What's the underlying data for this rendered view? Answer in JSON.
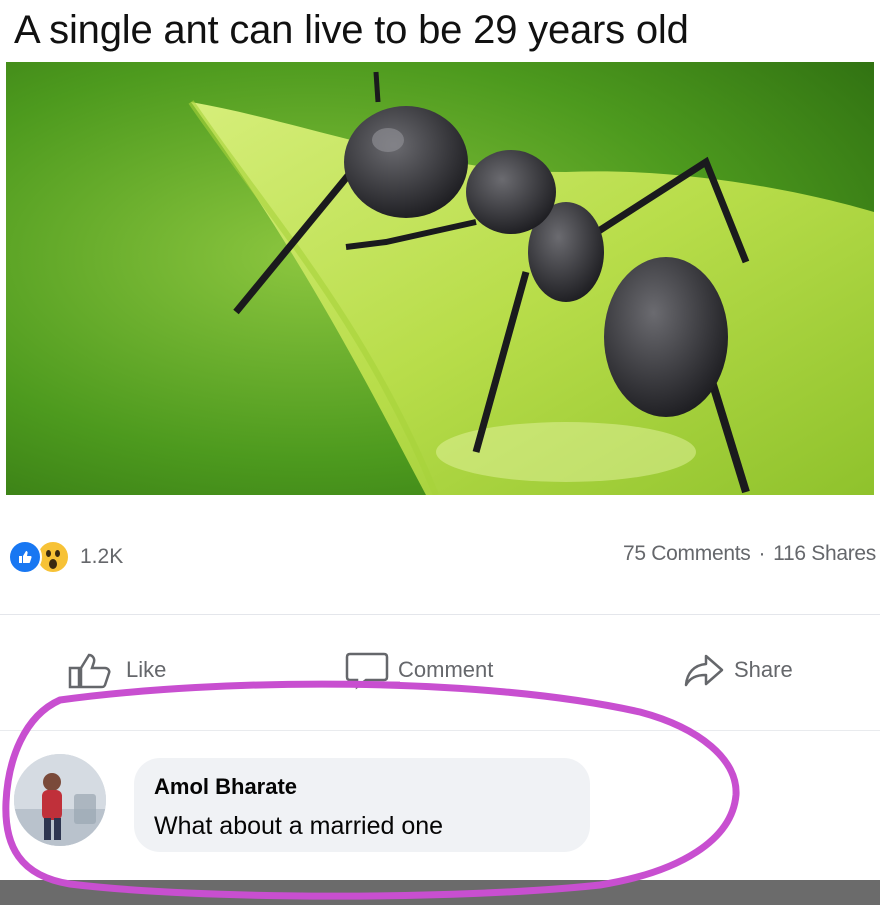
{
  "headline": "A single ant can live to be 29 years old",
  "photo": {
    "subject": "ant-on-leaf-photo"
  },
  "reactions": {
    "icons": [
      "like-reaction-icon",
      "wow-reaction-icon"
    ],
    "count": "1.2K",
    "comments": "75 Comments",
    "separator": "·",
    "shares": "116 Shares"
  },
  "actions": {
    "like": "Like",
    "comment": "Comment",
    "share": "Share"
  },
  "comment": {
    "author": "Amol Bharate",
    "text": "What about a married one"
  },
  "colors": {
    "facebook_blue": "#1877f2",
    "wow_yellow": "#f7c236",
    "annotation_magenta": "#c84fd0",
    "bubble_gray": "#f0f2f5"
  }
}
